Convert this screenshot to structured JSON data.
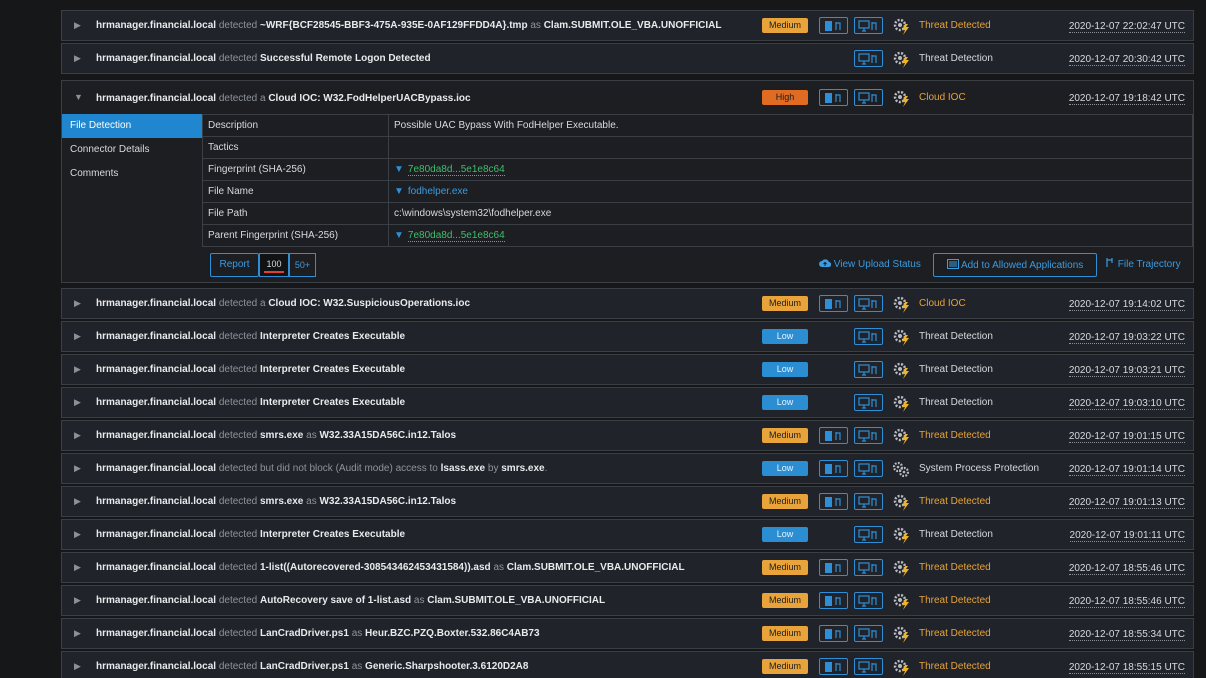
{
  "events_top": [
    {
      "host": "hrmanager.financial.local",
      "parts": [
        {
          "s": "detected ",
          "b": false
        },
        {
          "s": "~WRF{BCF28545-BBF3-475A-935E-0AF129FFDD4A}.tmp",
          "b": true
        },
        {
          "s": " as ",
          "b": false
        },
        {
          "s": "Clam.SUBMIT.OLE_VBA.UNOFFICIAL",
          "b": true
        }
      ],
      "severity": "Medium",
      "file_icon": true,
      "category": "Threat Detected",
      "cat_color": "orange",
      "date": "2020-12-07 22:02:47 UTC"
    },
    {
      "host": "hrmanager.financial.local",
      "parts": [
        {
          "s": "detected ",
          "b": false
        },
        {
          "s": "Successful Remote Logon Detected",
          "b": true
        }
      ],
      "severity": "",
      "file_icon": false,
      "category": "Threat Detection",
      "cat_color": "white",
      "date": "2020-12-07 20:30:42 UTC"
    }
  ],
  "expanded": {
    "host": "hrmanager.financial.local",
    "parts": [
      {
        "s": "detected a ",
        "b": false
      },
      {
        "s": "Cloud IOC: W32.FodHelperUACBypass.ioc",
        "b": true
      }
    ],
    "severity": "High",
    "category": "Cloud IOC",
    "date": "2020-12-07 19:18:42 UTC",
    "tabs": [
      "File Detection",
      "Connector Details",
      "Comments"
    ],
    "details": [
      {
        "k": "Description",
        "v": "Possible UAC Bypass With FodHelper Executable.",
        "type": "text"
      },
      {
        "k": "Tactics",
        "v": "",
        "type": "text"
      },
      {
        "k": "Fingerprint (SHA-256)",
        "v": "7e80da8d...5e1e8c64",
        "type": "hash"
      },
      {
        "k": "File Name",
        "v": "fodhelper.exe",
        "type": "file"
      },
      {
        "k": "File Path",
        "v": "c:\\windows\\system32\\fodhelper.exe",
        "type": "text"
      },
      {
        "k": "Parent Fingerprint (SHA-256)",
        "v": "7e80da8d...5e1e8c64",
        "type": "hash"
      }
    ],
    "report_label": "Report",
    "count_100": "100",
    "count_50": "50+",
    "view_upload": "View Upload Status",
    "add_allowed": "Add to Allowed Applications",
    "file_trajectory": "File Trajectory"
  },
  "events_bottom": [
    {
      "host": "hrmanager.financial.local",
      "parts": [
        {
          "s": "detected a ",
          "b": false
        },
        {
          "s": "Cloud IOC: W32.SuspiciousOperations.ioc",
          "b": true
        }
      ],
      "severity": "Medium",
      "file_icon": true,
      "category": "Cloud IOC",
      "cat_color": "orange",
      "date": "2020-12-07 19:14:02 UTC"
    },
    {
      "host": "hrmanager.financial.local",
      "parts": [
        {
          "s": "detected ",
          "b": false
        },
        {
          "s": "Interpreter Creates Executable",
          "b": true
        }
      ],
      "severity": "Low",
      "file_icon": false,
      "category": "Threat Detection",
      "cat_color": "white",
      "date": "2020-12-07 19:03:22 UTC"
    },
    {
      "host": "hrmanager.financial.local",
      "parts": [
        {
          "s": "detected ",
          "b": false
        },
        {
          "s": "Interpreter Creates Executable",
          "b": true
        }
      ],
      "severity": "Low",
      "file_icon": false,
      "category": "Threat Detection",
      "cat_color": "white",
      "date": "2020-12-07 19:03:21 UTC"
    },
    {
      "host": "hrmanager.financial.local",
      "parts": [
        {
          "s": "detected ",
          "b": false
        },
        {
          "s": "Interpreter Creates Executable",
          "b": true
        }
      ],
      "severity": "Low",
      "file_icon": false,
      "category": "Threat Detection",
      "cat_color": "white",
      "date": "2020-12-07 19:03:10 UTC"
    },
    {
      "host": "hrmanager.financial.local",
      "parts": [
        {
          "s": "detected ",
          "b": false
        },
        {
          "s": "smrs.exe",
          "b": true
        },
        {
          "s": " as ",
          "b": false
        },
        {
          "s": "W32.33A15DA56C.in12.Talos",
          "b": true
        }
      ],
      "severity": "Medium",
      "file_icon": true,
      "category": "Threat Detected",
      "cat_color": "orange",
      "date": "2020-12-07 19:01:15 UTC"
    },
    {
      "host": "hrmanager.financial.local",
      "parts": [
        {
          "s": "detected but did not block (Audit mode) access to ",
          "b": false
        },
        {
          "s": "lsass.exe",
          "b": true
        },
        {
          "s": " by ",
          "b": false
        },
        {
          "s": "smrs.exe",
          "b": true
        },
        {
          "s": ".",
          "b": false
        }
      ],
      "severity": "Low",
      "file_icon": true,
      "category": "System Process Protection",
      "cat_color": "white",
      "date": "2020-12-07 19:01:14 UTC",
      "gear_type": "sys"
    },
    {
      "host": "hrmanager.financial.local",
      "parts": [
        {
          "s": "detected ",
          "b": false
        },
        {
          "s": "smrs.exe",
          "b": true
        },
        {
          "s": " as ",
          "b": false
        },
        {
          "s": "W32.33A15DA56C.in12.Talos",
          "b": true
        }
      ],
      "severity": "Medium",
      "file_icon": true,
      "category": "Threat Detected",
      "cat_color": "orange",
      "date": "2020-12-07 19:01:13 UTC"
    },
    {
      "host": "hrmanager.financial.local",
      "parts": [
        {
          "s": "detected ",
          "b": false
        },
        {
          "s": "Interpreter Creates Executable",
          "b": true
        }
      ],
      "severity": "Low",
      "file_icon": false,
      "category": "Threat Detection",
      "cat_color": "white",
      "date": "2020-12-07 19:01:11 UTC"
    },
    {
      "host": "hrmanager.financial.local",
      "parts": [
        {
          "s": "detected ",
          "b": false
        },
        {
          "s": "1-list((Autorecovered-308543462453431584)).asd",
          "b": true
        },
        {
          "s": " as ",
          "b": false
        },
        {
          "s": "Clam.SUBMIT.OLE_VBA.UNOFFICIAL",
          "b": true
        }
      ],
      "severity": "Medium",
      "file_icon": true,
      "category": "Threat Detected",
      "cat_color": "orange",
      "date": "2020-12-07 18:55:46 UTC"
    },
    {
      "host": "hrmanager.financial.local",
      "parts": [
        {
          "s": "detected ",
          "b": false
        },
        {
          "s": "AutoRecovery save of 1-list.asd",
          "b": true
        },
        {
          "s": " as ",
          "b": false
        },
        {
          "s": "Clam.SUBMIT.OLE_VBA.UNOFFICIAL",
          "b": true
        }
      ],
      "severity": "Medium",
      "file_icon": true,
      "category": "Threat Detected",
      "cat_color": "orange",
      "date": "2020-12-07 18:55:46 UTC"
    },
    {
      "host": "hrmanager.financial.local",
      "parts": [
        {
          "s": "detected ",
          "b": false
        },
        {
          "s": "LanCradDriver.ps1",
          "b": true
        },
        {
          "s": " as ",
          "b": false
        },
        {
          "s": "Heur.BZC.PZQ.Boxter.532.86C4AB73",
          "b": true
        }
      ],
      "severity": "Medium",
      "file_icon": true,
      "category": "Threat Detected",
      "cat_color": "orange",
      "date": "2020-12-07 18:55:34 UTC"
    },
    {
      "host": "hrmanager.financial.local",
      "parts": [
        {
          "s": "detected ",
          "b": false
        },
        {
          "s": "LanCradDriver.ps1",
          "b": true
        },
        {
          "s": " as ",
          "b": false
        },
        {
          "s": "Generic.Sharpshooter.3.6120D2A8",
          "b": true
        }
      ],
      "severity": "Medium",
      "file_icon": true,
      "category": "Threat Detected",
      "cat_color": "orange",
      "date": "2020-12-07 18:55:15 UTC"
    }
  ]
}
